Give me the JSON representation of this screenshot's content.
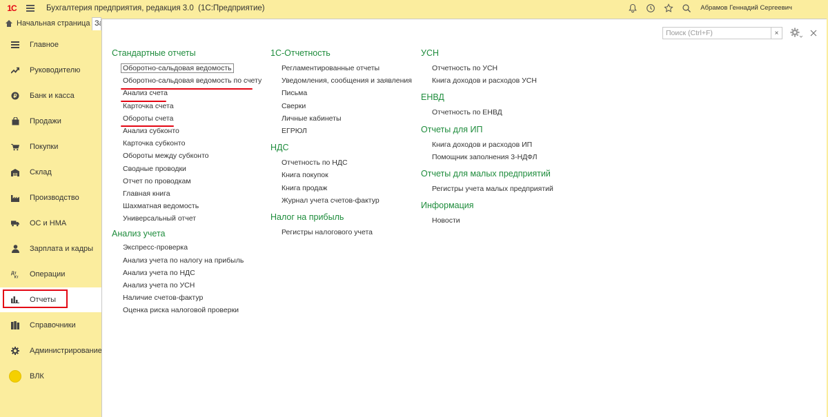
{
  "app": {
    "logo_text": "1С",
    "title": "Бухгалтерия предприятия, редакция 3.0",
    "subtitle": "(1С:Предприятие)",
    "user_name": "Абрамов Геннадий Сергеевич"
  },
  "tabs": {
    "home": "Начальная страница",
    "active": "Закладки"
  },
  "sidebar": {
    "items": [
      {
        "label": "Главное",
        "icon": "menu-icon"
      },
      {
        "label": "Руководителю",
        "icon": "chart-line-icon"
      },
      {
        "label": "Банк и касса",
        "icon": "coin-icon"
      },
      {
        "label": "Продажи",
        "icon": "bag-icon"
      },
      {
        "label": "Покупки",
        "icon": "cart-icon"
      },
      {
        "label": "Склад",
        "icon": "warehouse-icon"
      },
      {
        "label": "Производство",
        "icon": "factory-icon"
      },
      {
        "label": "ОС и НМА",
        "icon": "truck-icon"
      },
      {
        "label": "Зарплата и кадры",
        "icon": "person-icon"
      },
      {
        "label": "Операции",
        "icon": "operations-icon"
      },
      {
        "label": "Отчеты",
        "icon": "bar-chart-icon"
      },
      {
        "label": "Справочники",
        "icon": "books-icon"
      },
      {
        "label": "Администрирование",
        "icon": "gear-icon"
      },
      {
        "label": "ВЛК",
        "icon": "circle-icon"
      }
    ],
    "active_index": 10
  },
  "search": {
    "placeholder": "Поиск (Ctrl+F)",
    "clear": "×"
  },
  "columns": [
    {
      "sections": [
        {
          "title": "Стандартные отчеты",
          "links": [
            "Оборотно-сальдовая ведомость",
            "Оборотно-сальдовая ведомость по счету",
            "Анализ счета",
            "Карточка счета",
            "Обороты счета",
            "Анализ субконто",
            "Карточка субконто",
            "Обороты между субконто",
            "Сводные проводки",
            "Отчет по проводкам",
            "Главная книга",
            "Шахматная ведомость",
            "Универсальный отчет"
          ]
        },
        {
          "title": "Анализ учета",
          "links": [
            "Экспресс-проверка",
            "Анализ учета по налогу на прибыль",
            "Анализ учета по НДС",
            "Анализ учета по УСН",
            "Наличие счетов-фактур",
            "Оценка риска налоговой проверки"
          ]
        }
      ]
    },
    {
      "sections": [
        {
          "title": "1С-Отчетность",
          "links": [
            "Регламентированные отчеты",
            "Уведомления, сообщения и заявления",
            "Письма",
            "Сверки",
            "Личные кабинеты",
            "ЕГРЮЛ"
          ]
        },
        {
          "title": "НДС",
          "links": [
            "Отчетность по НДС",
            "Книга покупок",
            "Книга продаж",
            "Журнал учета счетов-фактур"
          ]
        },
        {
          "title": "Налог на прибыль",
          "links": [
            "Регистры налогового учета"
          ]
        }
      ]
    },
    {
      "sections": [
        {
          "title": "УСН",
          "links": [
            "Отчетность по УСН",
            "Книга доходов и расходов УСН"
          ]
        },
        {
          "title": "ЕНВД",
          "links": [
            "Отчетность по ЕНВД"
          ]
        },
        {
          "title": "Отчеты для ИП",
          "links": [
            "Книга доходов и расходов ИП",
            "Помощник заполнения 3-НДФЛ"
          ]
        },
        {
          "title": "Отчеты для малых предприятий",
          "links": [
            "Регистры учета малых предприятий"
          ]
        },
        {
          "title": "Информация",
          "links": [
            "Новости"
          ]
        }
      ]
    }
  ]
}
